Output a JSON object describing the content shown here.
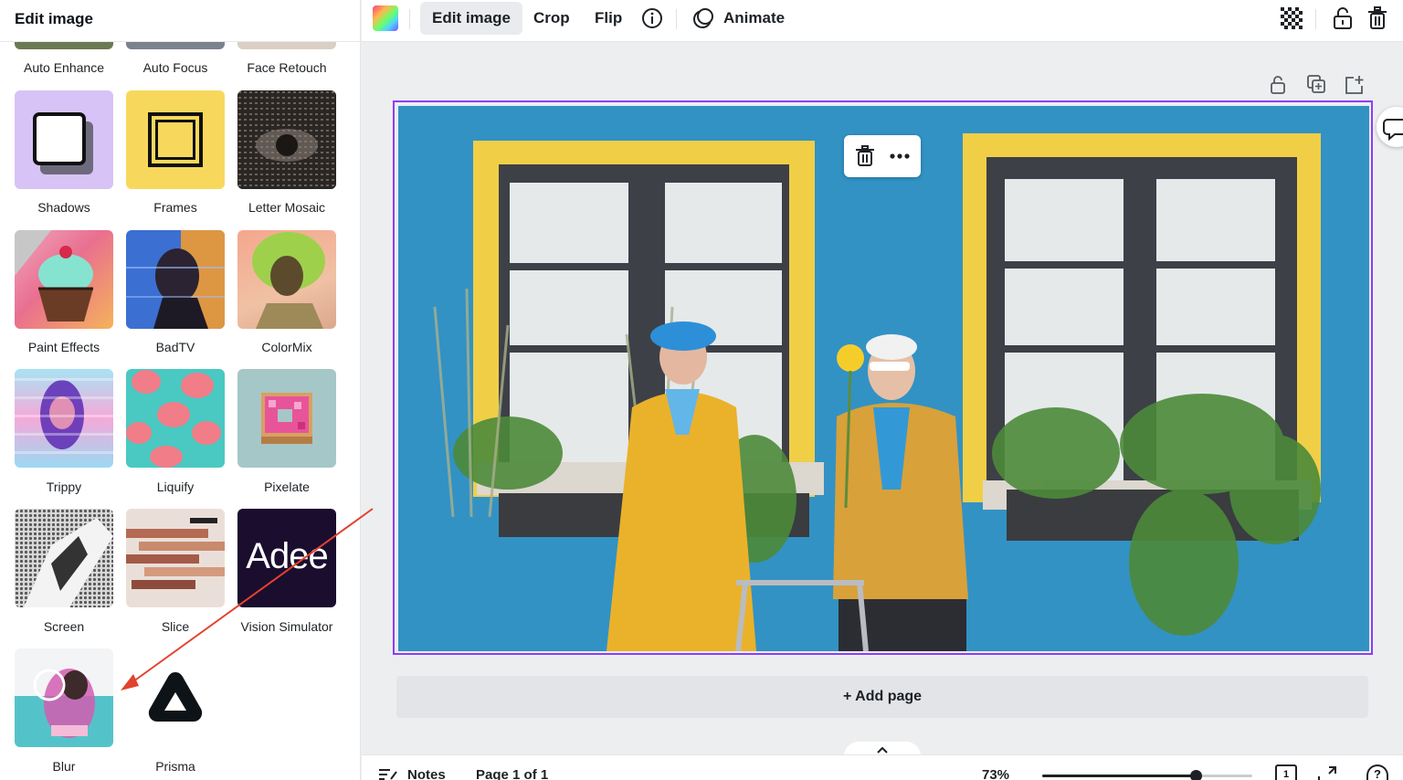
{
  "panel": {
    "title": "Edit image",
    "top_labels": [
      "Auto Enhance",
      "Auto Focus",
      "Face Retouch"
    ],
    "effects": [
      {
        "label": "Shadows",
        "icon": "shadows-thumbnail"
      },
      {
        "label": "Frames",
        "icon": "frames-thumbnail"
      },
      {
        "label": "Letter Mosaic",
        "icon": "letter-mosaic-thumbnail"
      },
      {
        "label": "Paint Effects",
        "icon": "paint-effects-thumbnail"
      },
      {
        "label": "BadTV",
        "icon": "badtv-thumbnail"
      },
      {
        "label": "ColorMix",
        "icon": "colormix-thumbnail"
      },
      {
        "label": "Trippy",
        "icon": "trippy-thumbnail"
      },
      {
        "label": "Liquify",
        "icon": "liquify-thumbnail"
      },
      {
        "label": "Pixelate",
        "icon": "pixelate-thumbnail"
      },
      {
        "label": "Screen",
        "icon": "screen-thumbnail"
      },
      {
        "label": "Slice",
        "icon": "slice-thumbnail"
      },
      {
        "label": "Vision Simulator",
        "icon": "vision-simulator-thumbnail"
      },
      {
        "label": "Blur",
        "icon": "blur-thumbnail"
      },
      {
        "label": "Prisma",
        "icon": "prisma-logo"
      }
    ],
    "vision_simulator_logo_text": "Adee"
  },
  "toolbar": {
    "edit_image": "Edit image",
    "crop": "Crop",
    "flip": "Flip",
    "animate": "Animate",
    "icons": [
      "color-picker-icon",
      "info-icon",
      "animate-icon",
      "transparency-icon",
      "lock-icon",
      "trash-icon"
    ]
  },
  "canvas": {
    "add_page": "+ Add page",
    "page_tool_icons": [
      "lock-icon",
      "duplicate-page-icon",
      "add-page-icon"
    ],
    "context_menu_icons": [
      "trash-icon",
      "more-options-icon"
    ]
  },
  "bottombar": {
    "notes": "Notes",
    "page_indicator": "Page 1 of 1",
    "zoom": "73%",
    "zoom_fraction": 0.73,
    "page_count_badge": "1"
  },
  "colors": {
    "selection": "#8b3dff",
    "annotation_arrow": "#e2422d",
    "wall_blue": "#2f8fc1",
    "window_frame_yellow": "#f0cf47"
  }
}
